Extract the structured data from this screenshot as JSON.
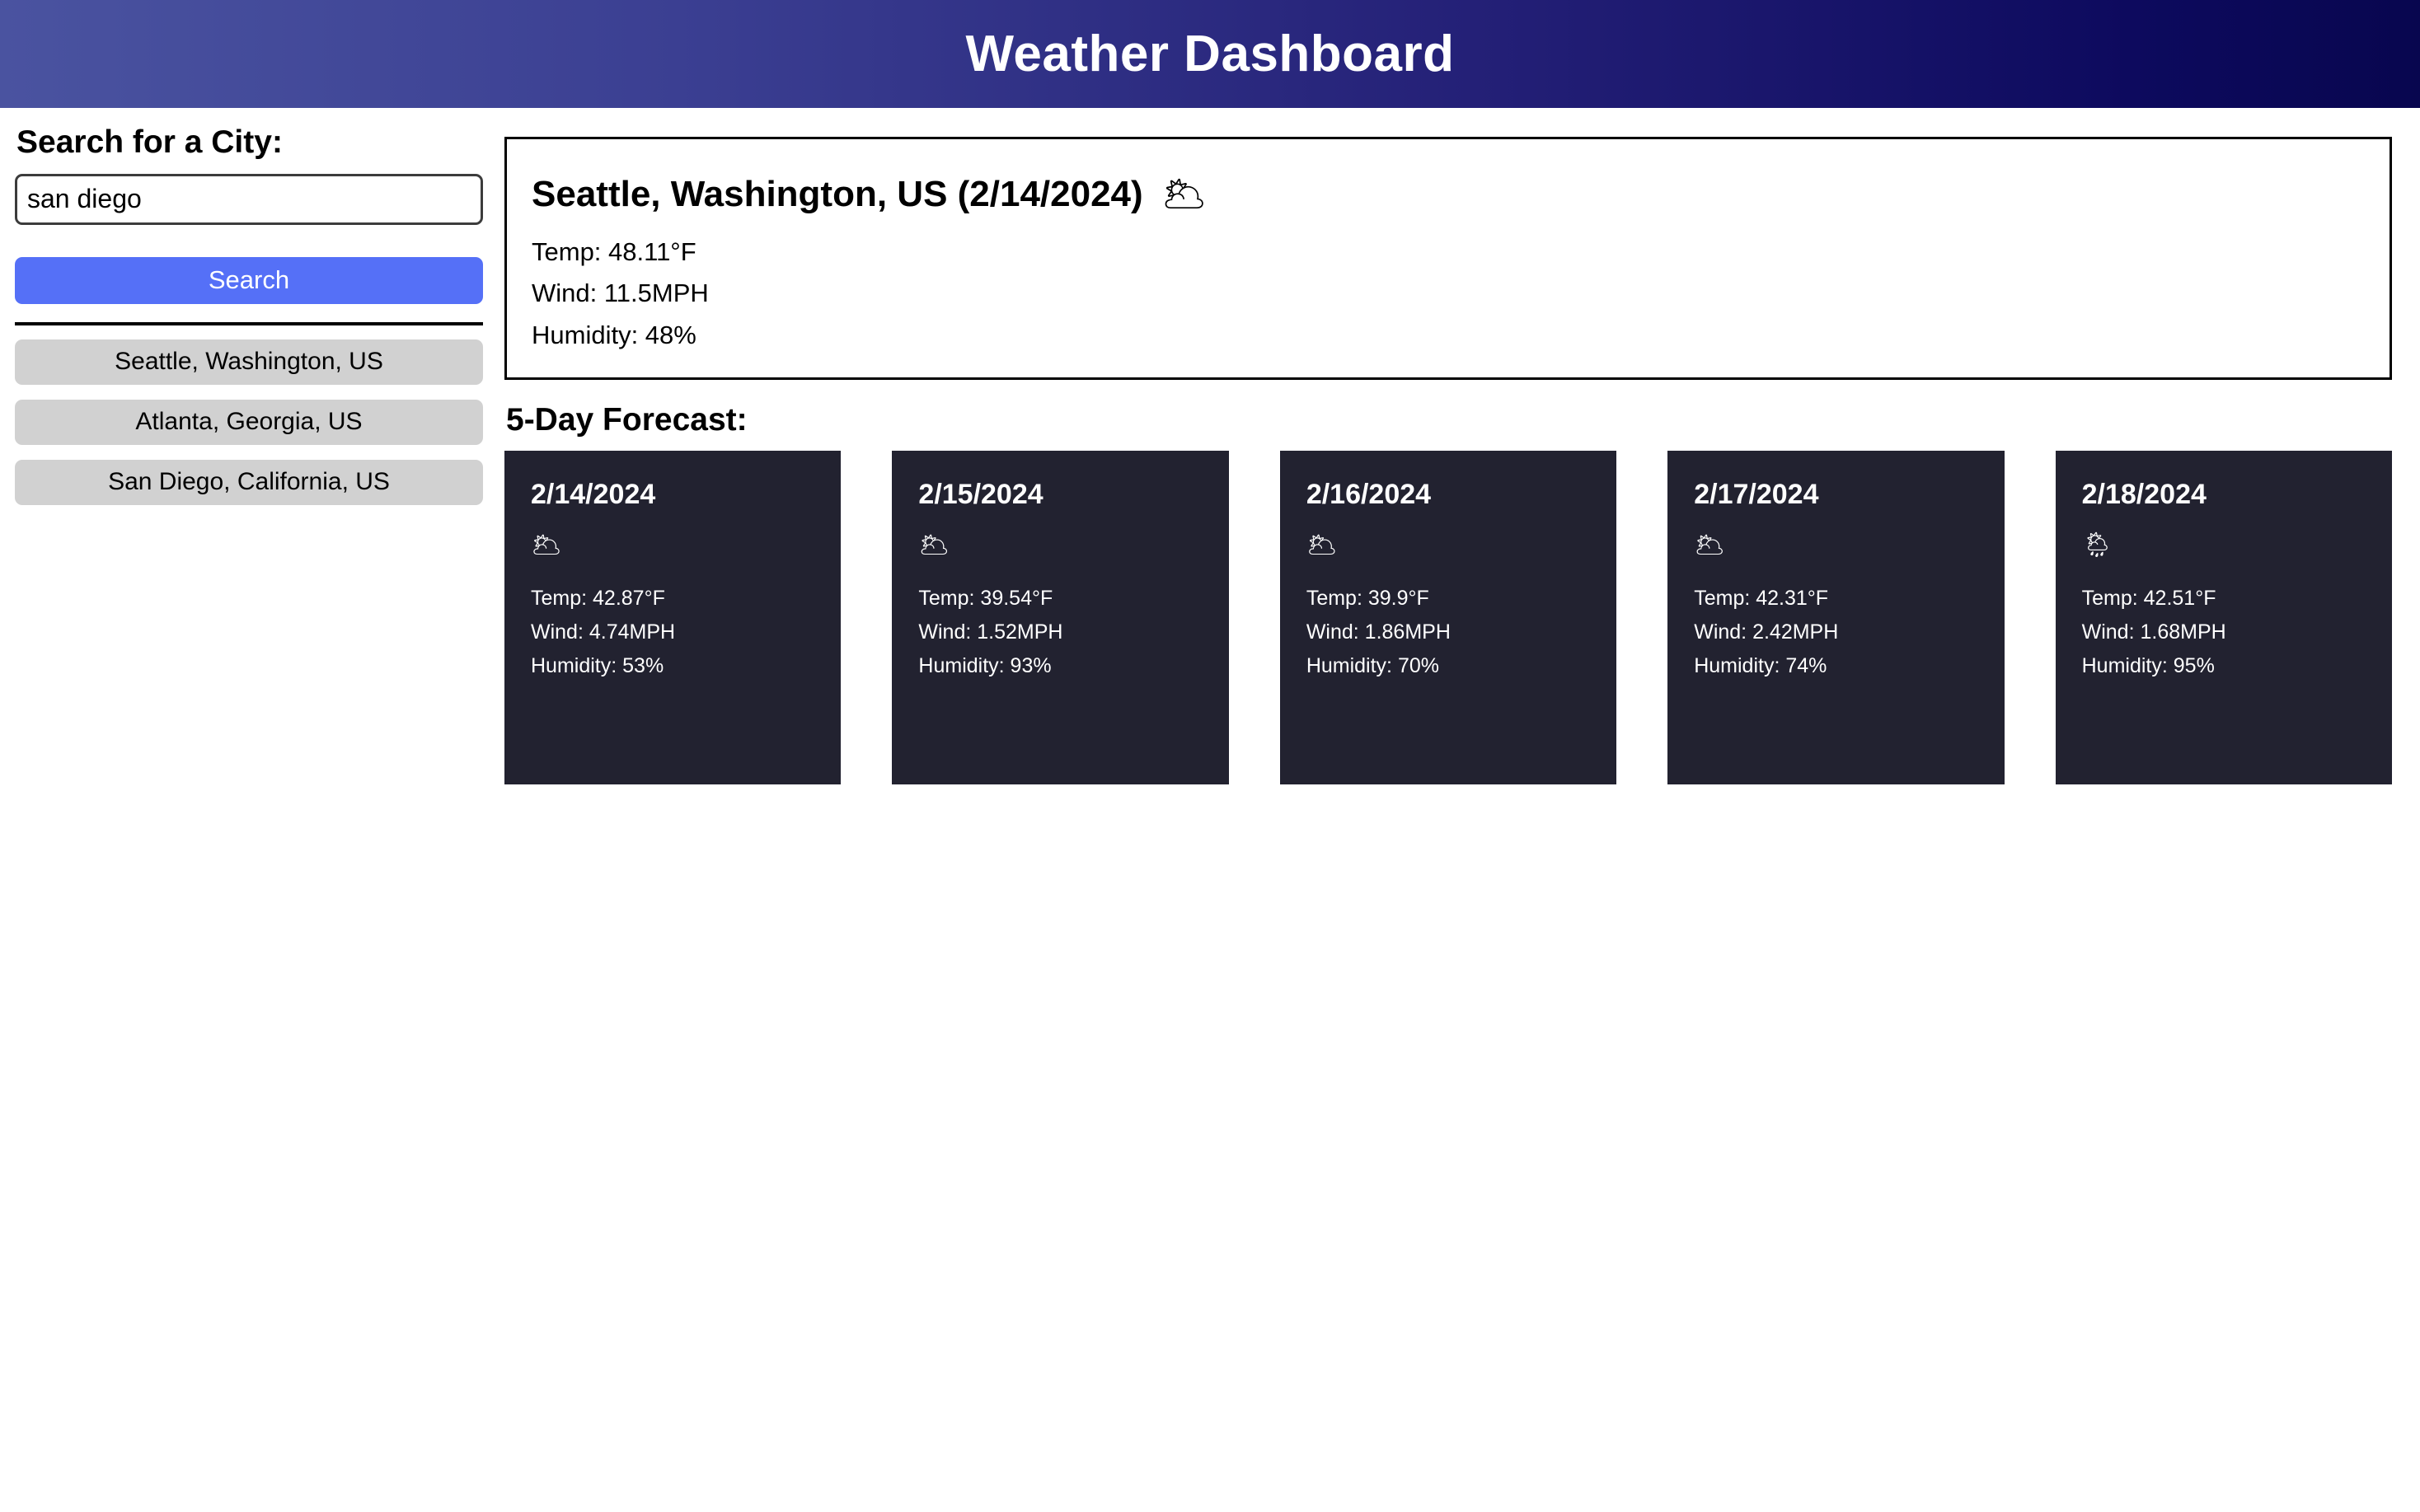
{
  "header": {
    "title": "Weather Dashboard",
    "gradient_from": "#4a53a0",
    "gradient_to": "#08064f"
  },
  "sidebar": {
    "search_label": "Search for a City:",
    "search_input_value": "san diego",
    "search_input_placeholder": "",
    "search_button_label": "Search",
    "history": [
      {
        "label": "Seattle, Washington, US"
      },
      {
        "label": "Atlanta, Georgia, US"
      },
      {
        "label": "San Diego, California, US"
      }
    ],
    "button_color": "#5570f7",
    "history_button_color": "#d1d1d1"
  },
  "current": {
    "title": "Seattle, Washington, US (2/14/2024)",
    "icon": "broken-clouds-icon",
    "icon_glyph": "🌥",
    "temp": "Temp: 48.11°F",
    "wind": "Wind: 11.5MPH",
    "humidity": "Humidity: 48%"
  },
  "forecast": {
    "heading": "5-Day Forecast:",
    "card_color": "#222230",
    "days": [
      {
        "date": "2/14/2024",
        "icon": "broken-clouds-icon",
        "icon_glyph": "🌥",
        "temp": "Temp: 42.87°F",
        "wind": "Wind: 4.74MPH",
        "humidity": "Humidity: 53%"
      },
      {
        "date": "2/15/2024",
        "icon": "broken-clouds-icon",
        "icon_glyph": "🌥",
        "temp": "Temp: 39.54°F",
        "wind": "Wind: 1.52MPH",
        "humidity": "Humidity: 93%"
      },
      {
        "date": "2/16/2024",
        "icon": "broken-clouds-icon",
        "icon_glyph": "🌥",
        "temp": "Temp: 39.9°F",
        "wind": "Wind: 1.86MPH",
        "humidity": "Humidity: 70%"
      },
      {
        "date": "2/17/2024",
        "icon": "broken-clouds-icon",
        "icon_glyph": "🌥",
        "temp": "Temp: 42.31°F",
        "wind": "Wind: 2.42MPH",
        "humidity": "Humidity: 74%"
      },
      {
        "date": "2/18/2024",
        "icon": "rain-cloud-icon",
        "icon_glyph": "🌦",
        "temp": "Temp: 42.51°F",
        "wind": "Wind: 1.68MPH",
        "humidity": "Humidity: 95%"
      }
    ]
  }
}
